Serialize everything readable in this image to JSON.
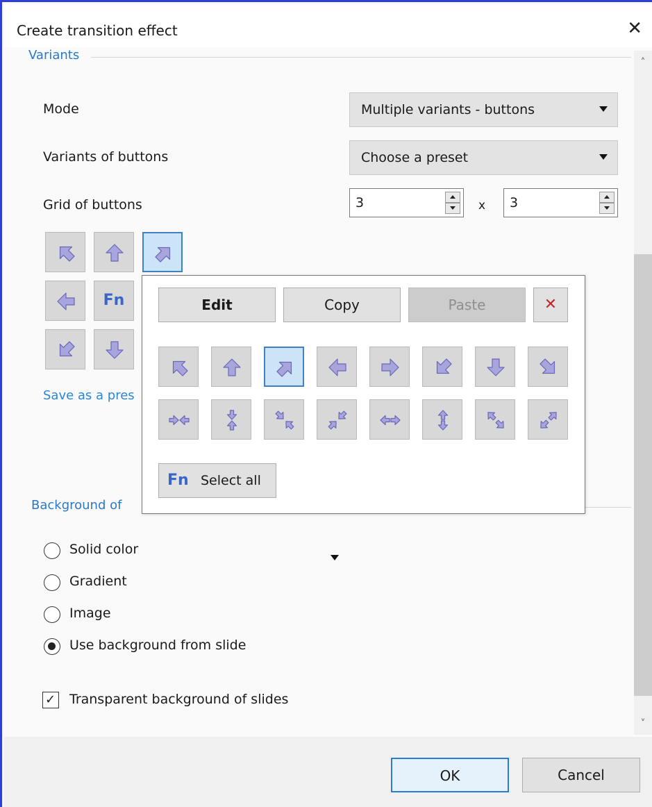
{
  "window": {
    "title": "Create transition effect"
  },
  "variants": {
    "section_label": "Variants",
    "mode_label": "Mode",
    "mode_value": "Multiple variants - buttons",
    "variants_label": "Variants of buttons",
    "variants_value": "Choose a preset",
    "grid_label": "Grid of buttons",
    "grid_cols": "3",
    "grid_x": "x",
    "grid_rows": "3",
    "grid_cells": [
      "arrow-up-left",
      "arrow-up",
      "arrow-up-right",
      "arrow-left",
      "Fn",
      "hidden",
      "arrow-down-left",
      "arrow-down",
      "hidden"
    ],
    "selected_cell": "arrow-up-right",
    "save_link": "Save as a pres"
  },
  "popup": {
    "edit_label": "Edit",
    "copy_label": "Copy",
    "paste_label": "Paste",
    "delete_label": "✕",
    "row1_icons": [
      "arrow-up-left",
      "arrow-up",
      "arrow-up-right",
      "arrow-left",
      "arrow-right",
      "arrow-down-left",
      "arrow-down",
      "arrow-down-right"
    ],
    "row2_icons": [
      "converge-horizontal",
      "converge-vertical",
      "converge-diagonal-a",
      "converge-diagonal-b",
      "expand-horizontal",
      "expand-vertical",
      "expand-diagonal-a",
      "expand-diagonal-b"
    ],
    "selected_icon": "arrow-up-right",
    "fn_label": "Fn",
    "select_all_label": "Select all"
  },
  "background": {
    "section_label": "Background of",
    "options": [
      "Solid color",
      "Gradient",
      "Image",
      "Use background from slide"
    ],
    "selected": "Use background from slide",
    "transparent_label": "Transparent background of slides",
    "transparent_checked": true
  },
  "footer": {
    "ok_label": "OK",
    "cancel_label": "Cancel"
  },
  "colors": {
    "accent": "#2a78c8",
    "icon_fill": "#a8a4dc",
    "icon_stroke": "#6b66b8",
    "selection": "#cce4f7"
  }
}
